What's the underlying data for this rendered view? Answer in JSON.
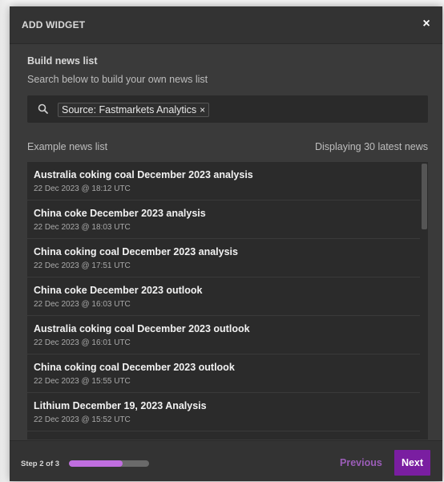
{
  "modal": {
    "title": "ADD WIDGET",
    "close_glyph": "×"
  },
  "build": {
    "title": "Build news list",
    "subtitle": "Search below to build your own news list"
  },
  "search": {
    "icon": "search-icon",
    "chip_label": "Source: Fastmarkets Analytics",
    "chip_remove_glyph": "×"
  },
  "list": {
    "label": "Example news list",
    "count_text": "Displaying 30 latest news",
    "items": [
      {
        "title": "Australia coking coal December 2023 analysis",
        "time": "22 Dec 2023 @ 18:12 UTC"
      },
      {
        "title": "China coke December 2023 analysis",
        "time": "22 Dec 2023 @ 18:03 UTC"
      },
      {
        "title": "China coking coal December 2023 analysis",
        "time": "22 Dec 2023 @ 17:51 UTC"
      },
      {
        "title": "China coke December 2023 outlook",
        "time": "22 Dec 2023 @ 16:03 UTC"
      },
      {
        "title": "Australia coking coal December 2023 outlook",
        "time": "22 Dec 2023 @ 16:01 UTC"
      },
      {
        "title": "China coking coal December 2023 outlook",
        "time": "22 Dec 2023 @ 15:55 UTC"
      },
      {
        "title": "Lithium December 19, 2023 Analysis",
        "time": "22 Dec 2023 @ 15:52 UTC"
      },
      {
        "title": "",
        "time": ""
      }
    ]
  },
  "footer": {
    "step_text": "Step 2 of 3",
    "progress_fraction": 0.667,
    "previous_label": "Previous",
    "next_label": "Next"
  },
  "colors": {
    "accent": "#7a1ea1",
    "progress": "#c06ee0",
    "previous_text": "#9b5db8",
    "modal_bg": "#3a3a3a",
    "list_bg": "#2b2b2b"
  }
}
